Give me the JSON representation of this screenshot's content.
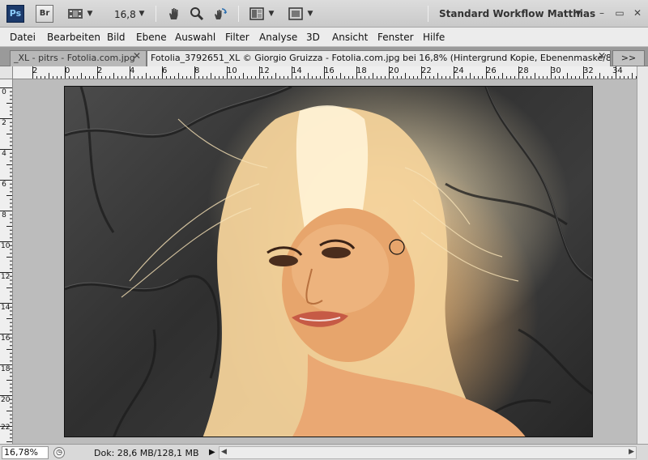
{
  "app": {
    "ps_logo": "Ps",
    "br_logo": "Br",
    "zoom_value": "16,8",
    "workspace_label": "Standard Workflow Matthias",
    "workspace_arrow": "▼",
    "window_controls": [
      "–",
      "▭",
      "✕"
    ],
    "icons": [
      "photoshop-logo-icon",
      "bridge-logo-icon",
      "film-icon",
      "hand-icon",
      "zoom-icon",
      "rotate-view-icon",
      "arrange-docs-icon",
      "screen-mode-icon"
    ]
  },
  "menu": {
    "items": [
      "Datei",
      "Bearbeiten",
      "Bild",
      "Ebene",
      "Auswahl",
      "Filter",
      "Analyse",
      "3D",
      "Ansicht",
      "Fenster",
      "Hilfe"
    ]
  },
  "tabs": {
    "inactive_label": "_XL - pitrs - Fotolia.com.jpg",
    "active_label": "Fotolia_3792651_XL © Giorgio Gruizza - Fotolia.com.jpg bei 16,8% (Hintergrund Kopie, Ebenenmaske/8) *",
    "close_glyph": "✕",
    "more_glyph": ">>"
  },
  "rulers": {
    "horizontal": [
      "2",
      "0",
      "2",
      "4",
      "6",
      "8",
      "10",
      "12",
      "14",
      "16",
      "18",
      "20",
      "22",
      "24",
      "26",
      "28",
      "30",
      "32",
      "34"
    ],
    "vertical": [
      "0",
      "2",
      "4",
      "6",
      "8",
      "10",
      "12",
      "14",
      "16",
      "18",
      "20",
      "22"
    ]
  },
  "status": {
    "zoom": "16,78%",
    "doc_info": "Dok: 28,6 MB/128,1 MB",
    "play_glyph": "▶"
  },
  "colors": {
    "accent": "#1c3a6b",
    "canvas_bg": "#bcbcbc"
  }
}
